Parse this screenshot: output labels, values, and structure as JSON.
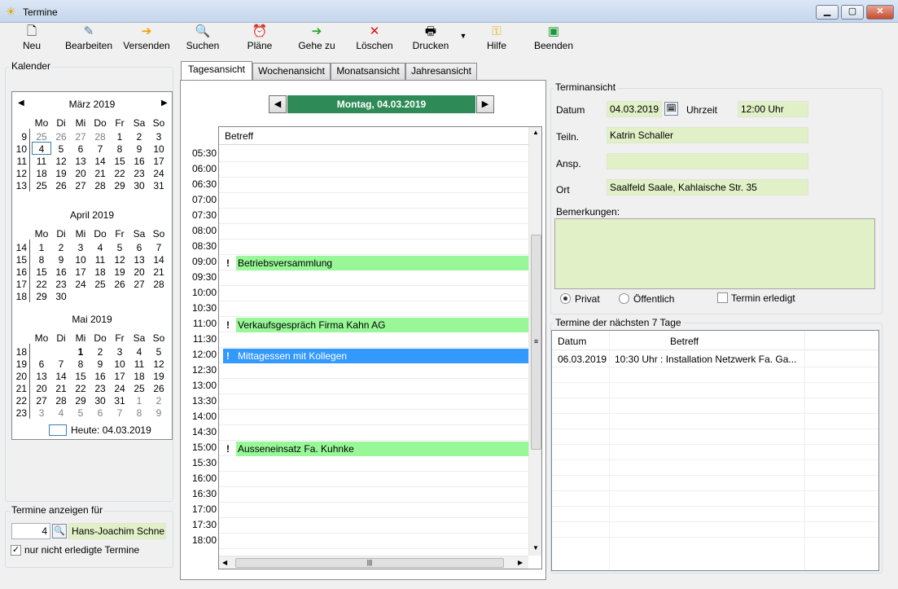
{
  "window": {
    "title": "Termine"
  },
  "toolbar": {
    "new": "Neu",
    "edit": "Bearbeiten",
    "send": "Versenden",
    "search": "Suchen",
    "plans": "Pläne",
    "goto": "Gehe zu",
    "delete": "Löschen",
    "print": "Drucken",
    "help": "Hilfe",
    "exit": "Beenden"
  },
  "sidebar": {
    "calendar_title": "Kalender",
    "weekdays": [
      "Mo",
      "Di",
      "Mi",
      "Do",
      "Fr",
      "Sa",
      "So"
    ],
    "months": [
      {
        "name": "März 2019",
        "weeks": [
          {
            "wk": "9",
            "days": [
              "25",
              "26",
              "27",
              "28",
              "1",
              "2",
              "3"
            ]
          },
          {
            "wk": "10",
            "days": [
              "4",
              "5",
              "6",
              "7",
              "8",
              "9",
              "10"
            ]
          },
          {
            "wk": "11",
            "days": [
              "11",
              "12",
              "13",
              "14",
              "15",
              "16",
              "17"
            ]
          },
          {
            "wk": "12",
            "days": [
              "18",
              "19",
              "20",
              "21",
              "22",
              "23",
              "24"
            ]
          },
          {
            "wk": "13",
            "days": [
              "25",
              "26",
              "27",
              "28",
              "29",
              "30",
              "31"
            ]
          }
        ]
      },
      {
        "name": "April 2019",
        "weeks": [
          {
            "wk": "14",
            "days": [
              "1",
              "2",
              "3",
              "4",
              "5",
              "6",
              "7"
            ]
          },
          {
            "wk": "15",
            "days": [
              "8",
              "9",
              "10",
              "11",
              "12",
              "13",
              "14"
            ]
          },
          {
            "wk": "16",
            "days": [
              "15",
              "16",
              "17",
              "18",
              "19",
              "20",
              "21"
            ]
          },
          {
            "wk": "17",
            "days": [
              "22",
              "23",
              "24",
              "25",
              "26",
              "27",
              "28"
            ]
          },
          {
            "wk": "18",
            "days": [
              "29",
              "30",
              "",
              "",
              "",
              "",
              ""
            ]
          }
        ]
      },
      {
        "name": "Mai 2019",
        "weeks": [
          {
            "wk": "18",
            "days": [
              "",
              "",
              "1",
              "2",
              "3",
              "4",
              "5"
            ]
          },
          {
            "wk": "19",
            "days": [
              "6",
              "7",
              "8",
              "9",
              "10",
              "11",
              "12"
            ]
          },
          {
            "wk": "20",
            "days": [
              "13",
              "14",
              "15",
              "16",
              "17",
              "18",
              "19"
            ]
          },
          {
            "wk": "21",
            "days": [
              "20",
              "21",
              "22",
              "23",
              "24",
              "25",
              "26"
            ]
          },
          {
            "wk": "22",
            "days": [
              "27",
              "28",
              "29",
              "30",
              "31",
              "1",
              "2"
            ]
          },
          {
            "wk": "23",
            "days": [
              "3",
              "4",
              "5",
              "6",
              "7",
              "8",
              "9"
            ]
          }
        ]
      }
    ],
    "today_label": "Heute: 04.03.2019",
    "show_for_title": "Termine anzeigen für",
    "user_number": "4",
    "user_name": "Hans-Joachim Schne",
    "only_open_label": "nur nicht erledigte Termine",
    "only_open_checked": "✓"
  },
  "tabs": [
    "Tagesansicht",
    "Wochenansicht",
    "Monatsansicht",
    "Jahresansicht"
  ],
  "dayview": {
    "date_label": "Montag, 04.03.2019",
    "column_header": "Betreff",
    "times": [
      "05:30",
      "06:00",
      "06:30",
      "07:00",
      "07:30",
      "08:00",
      "08:30",
      "09:00",
      "09:30",
      "10:00",
      "10:30",
      "11:00",
      "11:30",
      "12:00",
      "12:30",
      "13:00",
      "13:30",
      "14:00",
      "14:30",
      "15:00",
      "15:30",
      "16:00",
      "16:30",
      "17:00",
      "17:30",
      "18:00"
    ],
    "events": [
      {
        "time": "09:00",
        "title": "Betriebsversammlung",
        "selected": false
      },
      {
        "time": "11:00",
        "title": "Verkaufsgespräch Firma Kahn AG",
        "selected": false
      },
      {
        "time": "12:00",
        "title": "Mittagessen mit Kollegen",
        "selected": true
      },
      {
        "time": "15:00",
        "title": "Ausseneinsatz Fa. Kuhnke",
        "selected": false
      }
    ]
  },
  "detail": {
    "title": "Terminansicht",
    "date_label": "Datum",
    "date_value": "04.03.2019",
    "time_label": "Uhrzeit",
    "time_value": "12:00 Uhr",
    "participant_label": "Teiln.",
    "participant_value": "Katrin Schaller",
    "contact_label": "Ansp.",
    "contact_value": "",
    "place_label": "Ort",
    "place_value": "Saalfeld Saale, Kahlaische Str. 35",
    "notes_label": "Bemerkungen:",
    "private_label": "Privat",
    "public_label": "Öffentlich",
    "done_label": "Termin erledigt"
  },
  "upcoming": {
    "title": "Termine der nächsten 7 Tage",
    "headers": [
      "Datum",
      "Betreff"
    ],
    "rows": [
      {
        "date": "06.03.2019",
        "subject": "10:30 Uhr : Installation Netzwerk Fa. Ga..."
      }
    ]
  },
  "colors": {
    "accent_green": "#2e8b57",
    "event_green": "#98f898",
    "selected_blue": "#3399ff",
    "field_bg": "#e1f0c7"
  }
}
